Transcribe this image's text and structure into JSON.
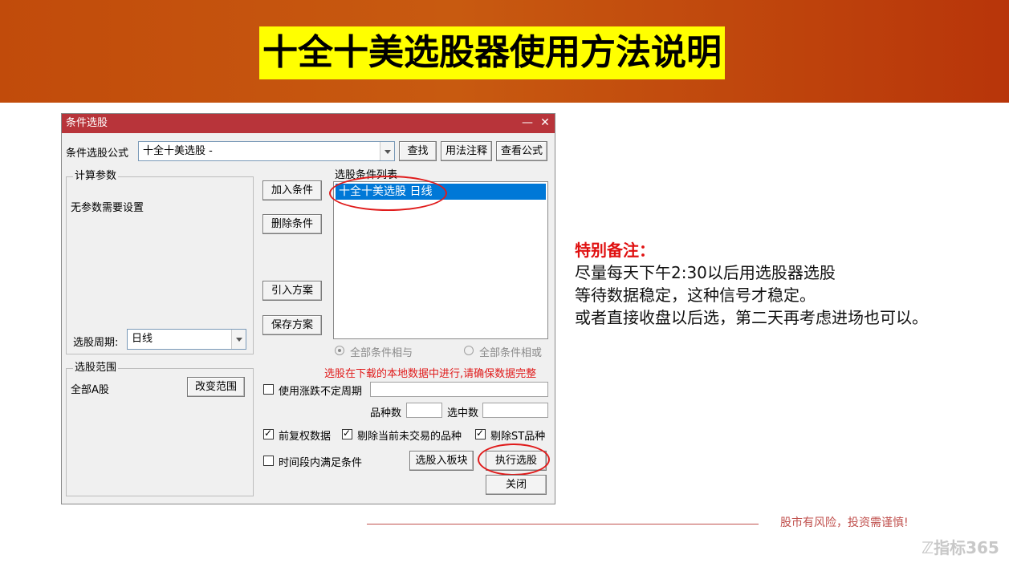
{
  "slide": {
    "title": "十全十美选股器使用方法说明",
    "notes_head": "特别备注：",
    "notes": [
      "尽量每天下午2:30以后用选股器选股",
      "等待数据稳定，这种信号才稳定。",
      "或者直接收盘以后选，第二天再考虑进场也可以。"
    ],
    "risk": "股市有风险，投资需谨慎!",
    "watermark": "指标365"
  },
  "window": {
    "title": "条件选股",
    "minimize": "—",
    "close": "✕",
    "formula_label": "条件选股公式",
    "formula_value": "十全十美选股 -",
    "find": "查找",
    "usage": "用法注释",
    "view": "查看公式",
    "calc_params": "计算参数",
    "no_params": "无参数需要设置",
    "add": "加入条件",
    "delete": "删除条件",
    "import": "引入方案",
    "save": "保存方案",
    "cond_list": "选股条件列表",
    "cond_item": "十全十美选股  日线",
    "period_label": "选股周期:",
    "period_value": "日线",
    "all_and": "全部条件相与",
    "all_or": "全部条件相或",
    "range": "选股范围",
    "range_value": "全部A股",
    "change_range": "改变范围",
    "warning": "选股在下载的本地数据中进行,请确保数据完整",
    "use_float": "使用涨跌不定周期",
    "count_label": "品种数",
    "selected_label": "选中数",
    "fwd_adjust": "前复权数据",
    "exclude_untraded": "剔除当前未交易的品种",
    "exclude_st": "剔除ST品种",
    "period_cond": "时间段内满足条件",
    "to_block": "选股入板块",
    "execute": "执行选股",
    "close_btn": "关闭"
  },
  "colors": {
    "highlight_red": "#e01b1b",
    "banner": "#c14b0b",
    "title_bg": "#ffff00",
    "window_title": "#b8343a",
    "selection": "#0078d7"
  }
}
